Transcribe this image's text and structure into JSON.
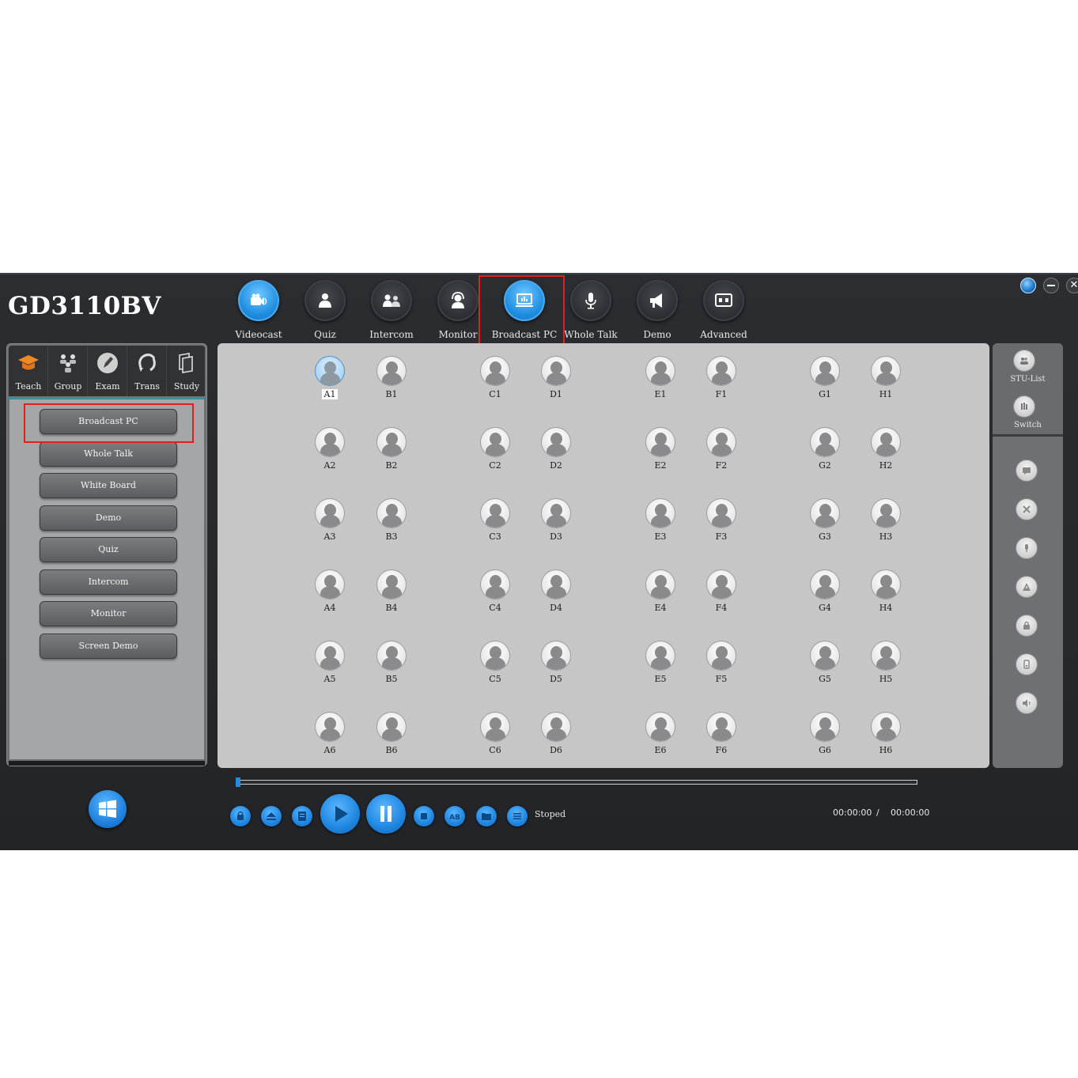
{
  "app": {
    "title": "GD3110BV"
  },
  "topnav": {
    "items": [
      {
        "label": "Videocast",
        "icon": "video-camera-icon",
        "active": true
      },
      {
        "label": "Quiz",
        "icon": "person-icon"
      },
      {
        "label": "Intercom",
        "icon": "two-people-icon"
      },
      {
        "label": "Monitor",
        "icon": "headset-icon"
      },
      {
        "label": "Broadcast PC",
        "icon": "monitor-icon",
        "active": true
      },
      {
        "label": "Whole Talk",
        "icon": "microphone-icon"
      },
      {
        "label": "Demo",
        "icon": "megaphone-icon"
      },
      {
        "label": "Advanced",
        "icon": "display-settings-icon"
      }
    ]
  },
  "left_tabs": {
    "items": [
      {
        "label": "Teach",
        "icon": "graduation-cap-icon"
      },
      {
        "label": "Group",
        "icon": "group-icon"
      },
      {
        "label": "Exam",
        "icon": "pen-icon"
      },
      {
        "label": "Trans",
        "icon": "transfer-icon"
      },
      {
        "label": "Study",
        "icon": "books-icon"
      }
    ]
  },
  "menu": {
    "items": [
      "Broadcast PC",
      "Whole Talk",
      "White Board",
      "Demo",
      "Quiz",
      "Intercom",
      "Monitor",
      "Screen Demo"
    ]
  },
  "seats": {
    "selected": "A1",
    "columns": [
      "A",
      "B",
      "C",
      "D",
      "E",
      "F",
      "G",
      "H"
    ],
    "rows": [
      "1",
      "2",
      "3",
      "4",
      "5",
      "6"
    ],
    "labels": {
      "A": [
        "A1",
        "A2",
        "A3",
        "A4",
        "A5",
        "A6"
      ],
      "B": [
        "B1",
        "B2",
        "B3",
        "B4",
        "B5",
        "B6"
      ],
      "C": [
        "C1",
        "C2",
        "C3",
        "C4",
        "C5",
        "C6"
      ],
      "D": [
        "D1",
        "D2",
        "D3",
        "D4",
        "D5",
        "D6"
      ],
      "E": [
        "E1",
        "E2",
        "E3",
        "E4",
        "E5",
        "E6"
      ],
      "F": [
        "F1",
        "F2",
        "F3",
        "F4",
        "F5",
        "F6"
      ],
      "G": [
        "G1",
        "G2",
        "G3",
        "G4",
        "G5",
        "G6"
      ],
      "H": [
        "H1",
        "H2",
        "H3",
        "H4",
        "H5",
        "H6"
      ]
    }
  },
  "right_panel": {
    "stu_list_label": "STU-List",
    "switch_label": "Switch",
    "tools": [
      "chat-icon",
      "close-icon",
      "microphone-icon",
      "warning-icon",
      "lock-icon",
      "device-icon",
      "speaker-icon"
    ]
  },
  "player": {
    "status": "Stoped",
    "current_time": "00:00:00",
    "separator": "/",
    "total_time": "00:00:00",
    "progress": 0
  },
  "colors": {
    "accent": "#1f8ee0",
    "highlight_box": "#e02020",
    "panel_bg": "#c6c6c7"
  }
}
